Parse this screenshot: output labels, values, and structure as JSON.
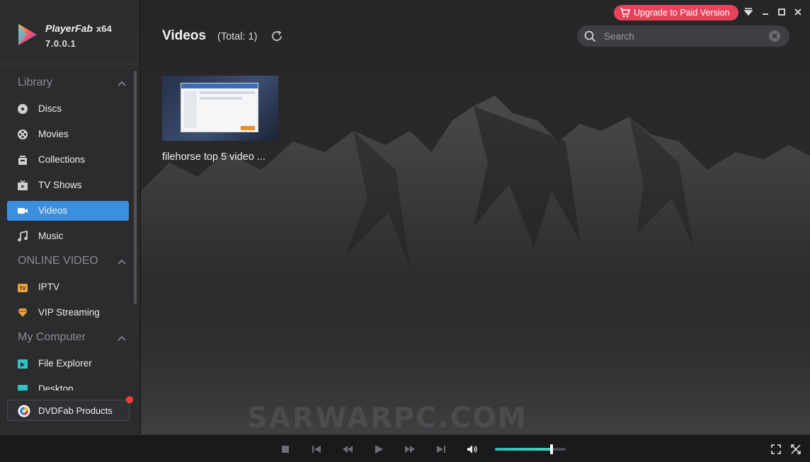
{
  "app": {
    "name": "PlayerFab",
    "arch": "x64",
    "version": "7.0.0.1"
  },
  "sidebar": {
    "sections": [
      {
        "title": "Library",
        "items": [
          {
            "label": "Discs",
            "icon": "disc-icon"
          },
          {
            "label": "Movies",
            "icon": "film-reel-icon"
          },
          {
            "label": "Collections",
            "icon": "collections-icon"
          },
          {
            "label": "TV Shows",
            "icon": "tv-icon"
          },
          {
            "label": "Videos",
            "icon": "video-camera-icon",
            "active": true
          },
          {
            "label": "Music",
            "icon": "music-note-icon"
          }
        ]
      },
      {
        "title": "ONLINE VIDEO",
        "items": [
          {
            "label": "IPTV",
            "icon": "iptv-icon"
          },
          {
            "label": "VIP Streaming",
            "icon": "diamond-icon"
          }
        ]
      },
      {
        "title": "My Computer",
        "items": [
          {
            "label": "File Explorer",
            "icon": "folder-icon"
          },
          {
            "label": "Desktop",
            "icon": "desktop-icon"
          }
        ]
      }
    ],
    "dvdfab_label": "DVDFab Products"
  },
  "header": {
    "title": "Videos",
    "total": "(Total: 1)",
    "upgrade_label": "Upgrade to Paid Version"
  },
  "search": {
    "placeholder": "Search",
    "value": ""
  },
  "videos": [
    {
      "title": "filehorse top 5 video ..."
    }
  ],
  "watermark": "SARWARPC.COM",
  "player": {
    "volume_level": 0.8
  },
  "colors": {
    "accent": "#3b8fdf",
    "upgrade": "#e8425a",
    "volume": "#44d1c2"
  }
}
